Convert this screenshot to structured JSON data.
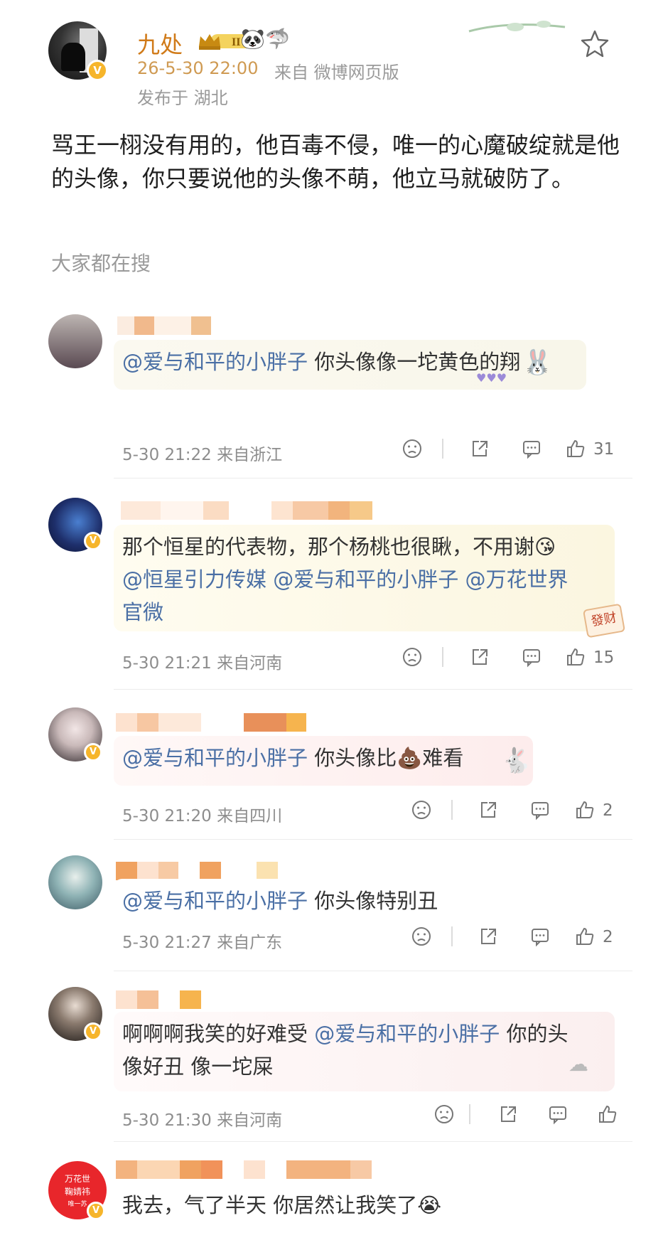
{
  "post": {
    "author": "九处",
    "level_badge": "II",
    "date_time": "26-5-30 22:00",
    "source": "来自 微博网页版",
    "location": "发布于 湖北",
    "text": "骂王一栩没有用的，他百毒不侵，唯一的心魔破绽就是他的头像，你只要说他的头像不萌，他立马就破防了。",
    "search_hint": "大家都在搜",
    "verified_mark": "V"
  },
  "comments": [
    {
      "mention": "@爱与和平的小胖子",
      "text": " 你头像像一坨黄色的翔",
      "time": "5-30 21:22",
      "region": "来自浙江",
      "likes": "31"
    },
    {
      "text_lead": "那个恒星的代表物，那个杨桃也很瞅，不用谢😘",
      "mentions_line": [
        "@恒星引力传媒",
        "@爱与和平的小胖子",
        "@万花世界"
      ],
      "text_tail": "官微",
      "sticker_label": "發财",
      "time": "5-30 21:21",
      "region": "来自河南",
      "likes": "15"
    },
    {
      "mention": "@爱与和平的小胖子",
      "text": " 你头像比💩难看",
      "time": "5-30 21:20",
      "region": "来自四川",
      "likes": "2"
    },
    {
      "mention": "@爱与和平的小胖子",
      "text": " 你头像特别丑",
      "time": "5-30 21:27",
      "region": "来自广东",
      "likes": "2"
    },
    {
      "text_lead": "啊啊啊我笑的好难受 ",
      "mention": "@爱与和平的小胖子",
      "text_tail": " 你的头",
      "line2": "像好丑 像一坨屎",
      "time": "5-30 21:30",
      "region": "来自河南",
      "likes": ""
    },
    {
      "text": "我去，气了半天 你居然让我笑了😭",
      "avatar_text": [
        "万花世",
        "鞠婧祎",
        "唯一苏"
      ]
    }
  ],
  "colors": {
    "author_orange": "#d07a18",
    "mention_blue": "#4a6fa5",
    "meta_gray": "#8d8d8d",
    "verified_gold": "#f6b52b"
  },
  "icons": [
    "star-icon",
    "dislike-icon",
    "share-icon",
    "comment-icon",
    "like-icon"
  ]
}
